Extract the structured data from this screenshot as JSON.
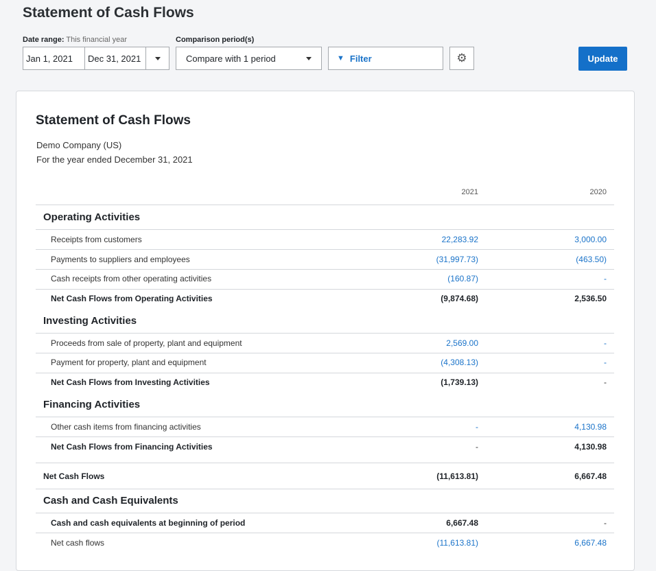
{
  "page": {
    "title": "Statement of Cash Flows"
  },
  "toolbar": {
    "date_range_label": "Date range:",
    "date_range_value": "This financial year",
    "comparison_label": "Comparison period(s)",
    "start_date": "Jan 1, 2021",
    "end_date": "Dec 31, 2021",
    "compare_value": "Compare with 1 period",
    "filter_label": "Filter",
    "update_label": "Update"
  },
  "report": {
    "title": "Statement of Cash Flows",
    "company": "Demo Company (US)",
    "period": "For the year ended December 31, 2021",
    "col_2021": "2021",
    "col_2020": "2020",
    "sections": [
      {
        "title": "Operating Activities"
      },
      {
        "title": "Investing Activities"
      },
      {
        "title": "Financing Activities"
      },
      {
        "title": "Cash and Cash Equivalents"
      }
    ],
    "rows": [
      {
        "label": "Receipts from customers",
        "v2021": "22,283.92",
        "v2020": "3,000.00"
      },
      {
        "label": "Payments to suppliers and employees",
        "v2021": "(31,997.73)",
        "v2020": "(463.50)"
      },
      {
        "label": "Cash receipts from other operating activities",
        "v2021": "(160.87)",
        "v2020": "-"
      },
      {
        "label": "Net Cash Flows from Operating Activities",
        "v2021": "(9,874.68)",
        "v2020": "2,536.50"
      },
      {
        "label": "Proceeds from sale of property, plant and equipment",
        "v2021": "2,569.00",
        "v2020": "-"
      },
      {
        "label": "Payment for property, plant and equipment",
        "v2021": "(4,308.13)",
        "v2020": "-"
      },
      {
        "label": "Net Cash Flows from Investing Activities",
        "v2021": "(1,739.13)",
        "v2020": "-"
      },
      {
        "label": "Other cash items from financing activities",
        "v2021": "-",
        "v2020": "4,130.98"
      },
      {
        "label": "Net Cash Flows from Financing Activities",
        "v2021": "-",
        "v2020": "4,130.98"
      },
      {
        "label": "Net Cash Flows",
        "v2021": "(11,613.81)",
        "v2020": "6,667.48"
      },
      {
        "label": "Cash and cash equivalents at beginning of period",
        "v2021": "6,667.48",
        "v2020": "-"
      },
      {
        "label": "Net cash flows",
        "v2021": "(11,613.81)",
        "v2020": "6,667.48"
      }
    ]
  }
}
